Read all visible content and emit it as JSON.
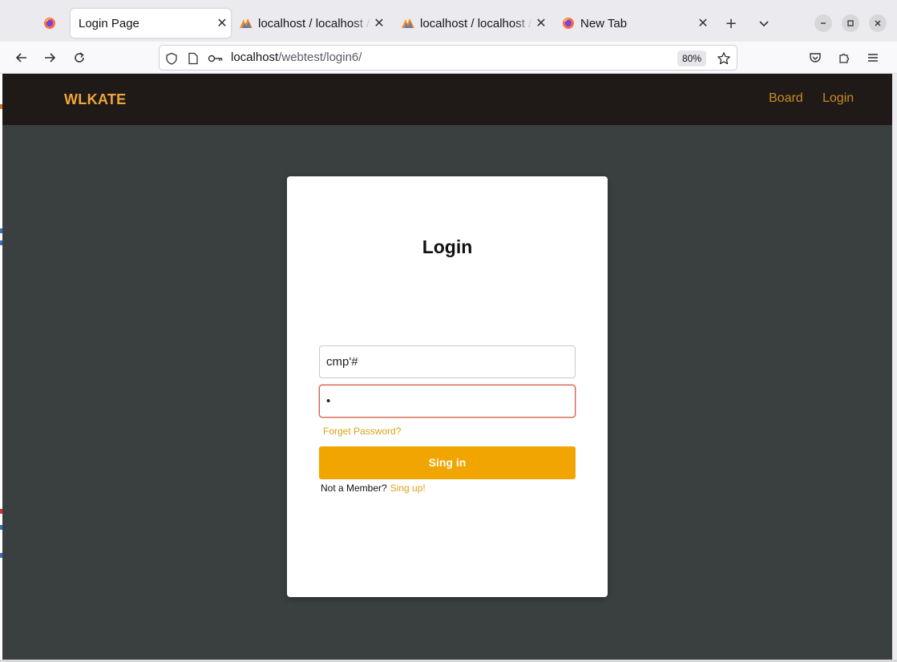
{
  "browser": {
    "tabs": [
      {
        "label": "Login Page",
        "active": true,
        "icon": "firefox-icon"
      },
      {
        "label": "localhost / localhost / ",
        "active": false,
        "icon": "phpmyadmin-icon"
      },
      {
        "label": "localhost / localhost / ",
        "active": false,
        "icon": "phpmyadmin-icon"
      },
      {
        "label": "New Tab",
        "active": false,
        "icon": "firefox-icon"
      }
    ],
    "url_host": "localhost",
    "url_path": "/webtest/login6/",
    "zoom": "80%"
  },
  "site": {
    "brand": "WLKATE",
    "nav": {
      "board": "Board",
      "login": "Login"
    }
  },
  "login": {
    "title": "Login",
    "username_value": "cmp'#",
    "password_value": "•",
    "forget_label": "Forget Password?",
    "submit_label": "Sing in",
    "member_text": "Not a Member?",
    "signup_label": "Sing up!"
  },
  "colors": {
    "accent": "#f0a500",
    "brand": "#f0a53b",
    "navbar": "#1f1a17",
    "page_bg": "#3a3f40",
    "error_border": "#d45f48"
  }
}
